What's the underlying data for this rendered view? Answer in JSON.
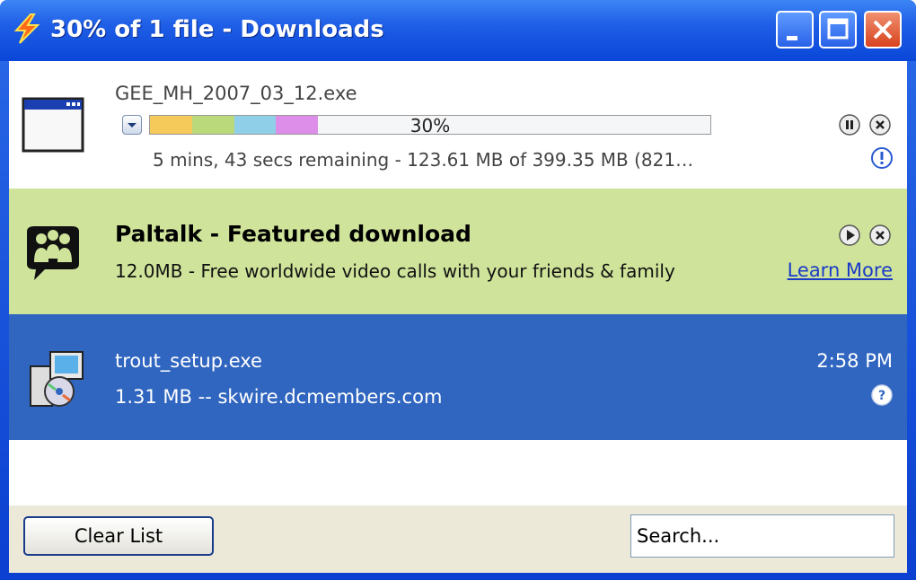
{
  "window": {
    "title": "30% of 1 file - Downloads",
    "icon": "lightning-bolt-icon"
  },
  "downloads": [
    {
      "filename": "GEE_MH_2007_03_12.exe",
      "progress_percent": 30,
      "progress_label": "30%",
      "status": "5 mins, 43 secs remaining - 123.61 MB of 399.35 MB (821…",
      "icon": "application-window-icon",
      "actions": [
        "pause-icon",
        "cancel-icon",
        "info-icon"
      ]
    },
    {
      "title": "Paltalk - Featured download",
      "description": "12.0MB - Free worldwide video calls with your friends & family",
      "link": "Learn More",
      "icon": "paltalk-people-icon",
      "actions": [
        "play-icon",
        "cancel-icon"
      ]
    },
    {
      "filename": "trout_setup.exe",
      "info": "1.31 MB -- skwire.dcmembers.com",
      "time": "2:58 PM",
      "icon": "installer-icon",
      "actions": [
        "help-icon"
      ]
    }
  ],
  "footer": {
    "clear_label": "Clear List",
    "search_placeholder": "Search..."
  },
  "colors": {
    "featured_bg": "#cfe49a",
    "selected_bg": "#3066c0",
    "progress_segments": [
      "#f5c95a",
      "#b9d97a",
      "#8fd0e8",
      "#dc8ee8"
    ]
  }
}
